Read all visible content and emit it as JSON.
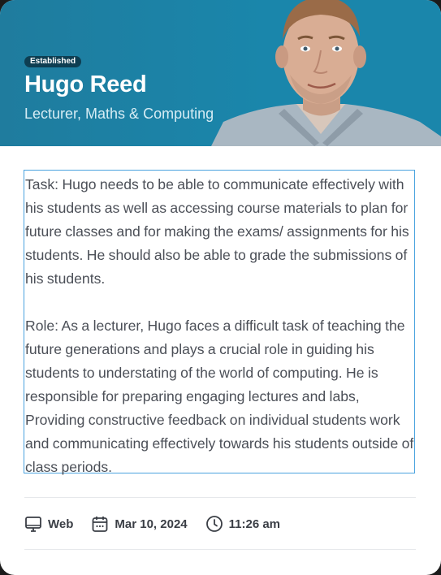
{
  "profile": {
    "badge": "Established",
    "name": "Hugo Reed",
    "title": "Lecturer, Maths & Computing"
  },
  "description": "Task: Hugo needs to be able to communicate effectively with his students as well as accessing course materials to plan for future classes and for making the exams/ assignments for his students. He should also be able to grade the submissions of his students.\n\nRole: As a lecturer, Hugo faces a difficult task of teaching the future generations and plays a crucial role in guiding his students to understating of the world of computing. He is responsible for preparing engaging lectures and labs, Providing constructive feedback on individual students work and communicating effectively towards his students outside of class periods.",
  "meta": {
    "platform": "Web",
    "date": "Mar 10, 2024",
    "time": "11:26 am"
  },
  "colors": {
    "header": "#1a86ab",
    "badge": "#0e3e52",
    "selection_border": "#4aa3df"
  },
  "icons": [
    "monitor-icon",
    "calendar-icon",
    "clock-icon"
  ]
}
